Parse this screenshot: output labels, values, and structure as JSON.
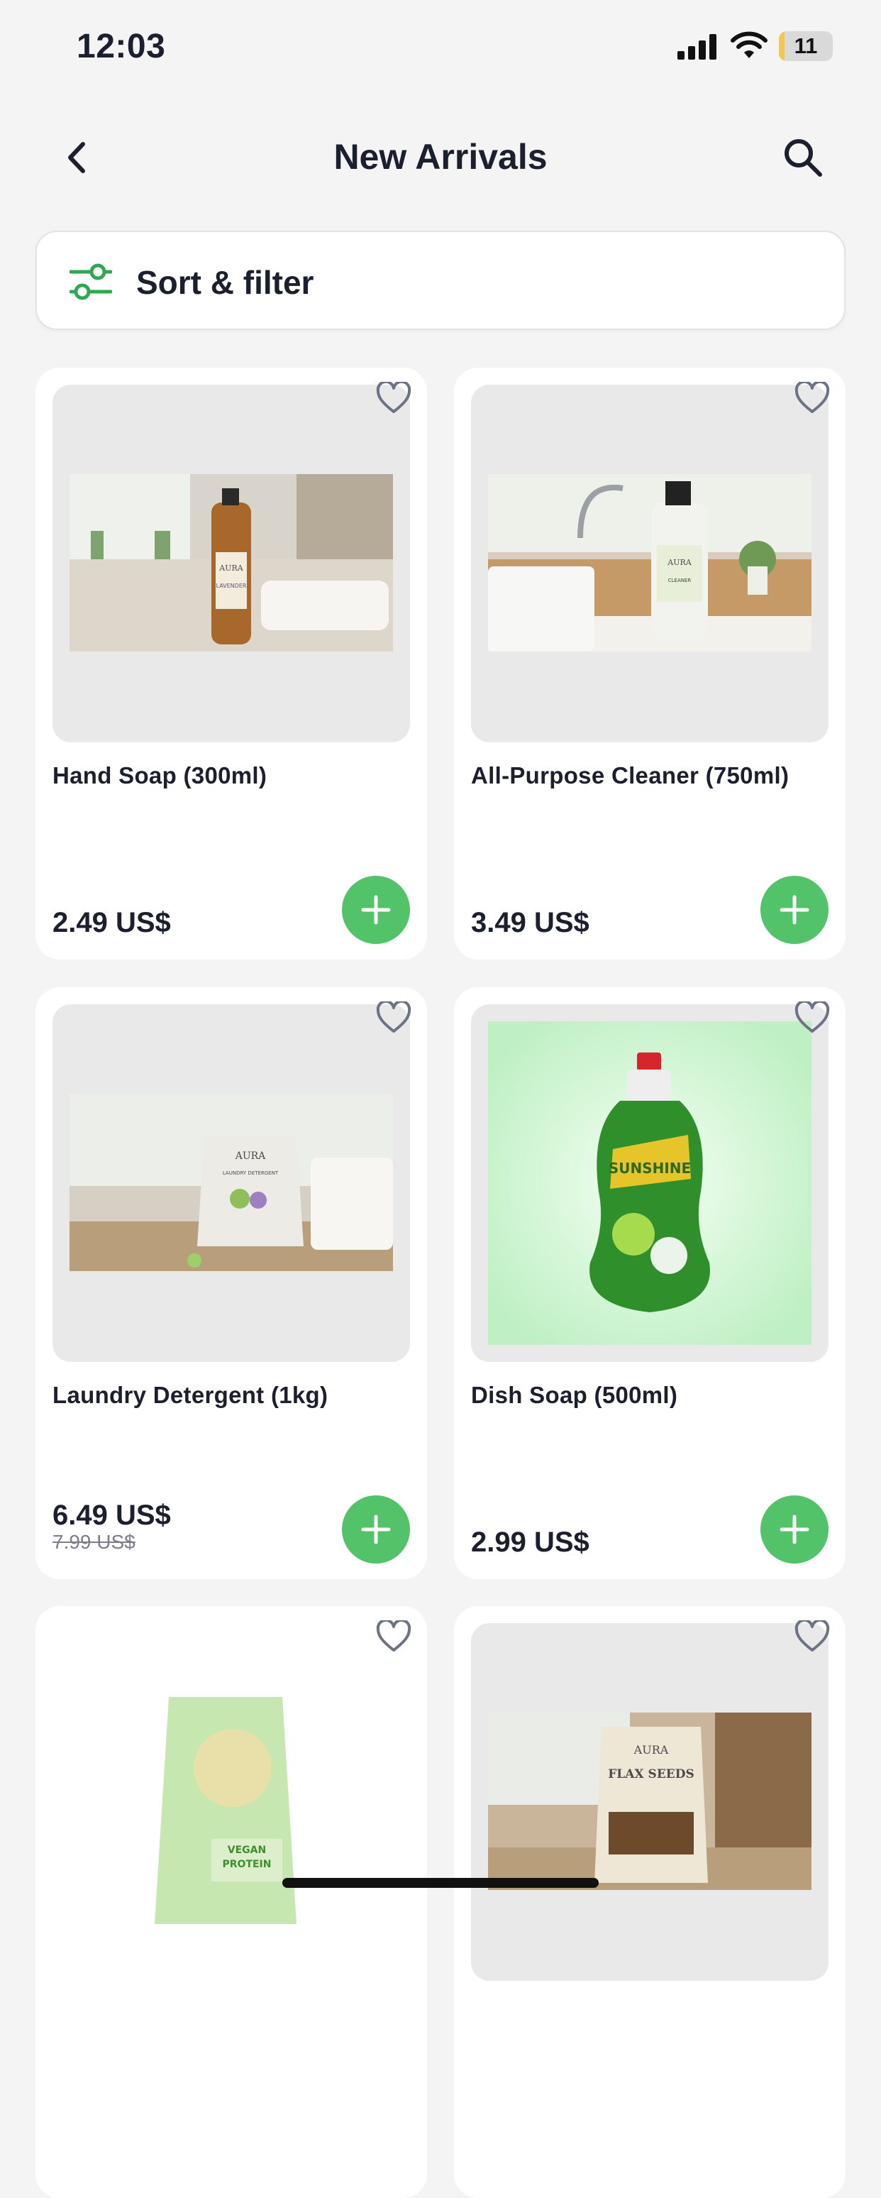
{
  "status": {
    "time": "12:03",
    "battery": "11",
    "battery_level": 0.11
  },
  "header": {
    "title": "New Arrivals",
    "back_icon": "chevron-left-icon",
    "search_icon": "search-icon"
  },
  "filter": {
    "label": "Sort & filter",
    "icon": "sliders-icon"
  },
  "colors": {
    "accent": "#53c36a",
    "background": "#f4f4f5",
    "card": "#ffffff",
    "text": "#1c1f2e"
  },
  "products": [
    {
      "name": "Hand Soap (300ml)",
      "price": "2.49 US$",
      "old_price": "",
      "image_label": "AURA · LAVENDER & BERGAMOT"
    },
    {
      "name": "All-Purpose Cleaner (750ml)",
      "price": "3.49 US$",
      "old_price": "",
      "image_label": "AURA · ALL-PURPOSE CLEANER"
    },
    {
      "name": "Laundry Detergent (1kg)",
      "price": "6.49 US$",
      "old_price": "7.99 US$",
      "image_label": "AURA · ALL-PURPOSE LAUNDRY DETERGENT"
    },
    {
      "name": "Dish Soap (500ml)",
      "price": "2.99 US$",
      "old_price": "",
      "image_label": "SUNSHINE"
    },
    {
      "name": "",
      "price": "",
      "old_price": "",
      "image_label": "VEGAN PROTEIN"
    },
    {
      "name": "",
      "price": "",
      "old_price": "",
      "image_label": "AURA · FLAX SEEDS"
    }
  ]
}
